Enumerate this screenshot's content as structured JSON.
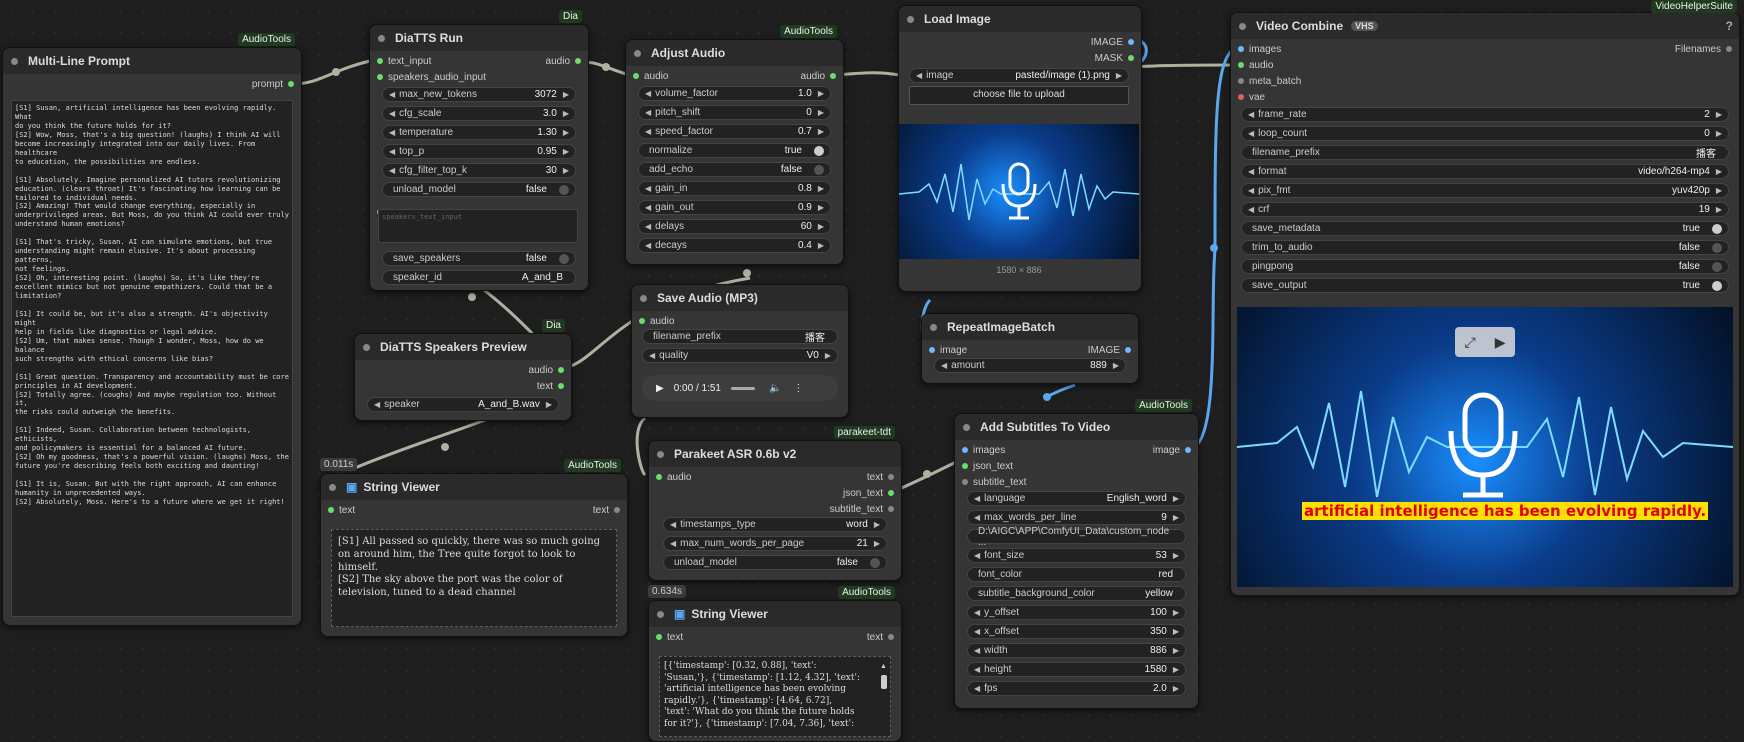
{
  "nodes": {
    "multi_line_prompt": {
      "title": "Multi-Line Prompt",
      "badge": "AudioTools",
      "out_prompt": "prompt",
      "text": "[S1] Susan, artificial intelligence has been evolving rapidly. What\ndo you think the future holds for it?\n[S2] Wow, Moss, that's a big question! (laughs) I think AI will\nbecome increasingly integrated into our daily lives. From healthcare\nto education, the possibilities are endless.\n\n[S1] Absolutely. Imagine personalized AI tutors revolutionizing\neducation. (clears throat) It's fascinating how learning can be\ntailored to individual needs.\n[S2] Amazing! That would change everything, especially in\nunderprivileged areas. But Moss, do you think AI could ever truly\nunderstand human emotions?\n\n[S1] That's tricky, Susan. AI can simulate emotions, but true\nunderstanding might remain elusive. It's about processing patterns,\nnot feelings.\n[S2] Oh, interesting point. (laughs) So, it's like they're\nexcellent mimics but not genuine empathizers. Could that be a\nlimitation?\n\n[S1] It could be, but it's also a strength. AI's objectivity might\nhelp in fields like diagnostics or legal advice.\n[S2] Um, that makes sense. Though I wonder, Moss, how do we balance\nsuch strengths with ethical concerns like bias?\n\n[S1] Great question. Transparency and accountability must be core\nprinciples in AI development.\n[S2] Totally agree. (coughs) And maybe regulation too. Without it,\nthe risks could outweigh the benefits.\n\n[S1] Indeed, Susan. Collaboration between technologists, ethicists,\nand policymakers is essential for a balanced AI future.\n[S2] Oh my goodness, that's a powerful vision. (laughs) Moss, the\nfuture you're describing feels both exciting and daunting!\n\n[S1] It is, Susan. But with the right approach, AI can enhance\nhumanity in unprecedented ways.\n[S2] Absolutely, Moss. Here's to a future where we get it right!"
    },
    "diatts_run": {
      "title": "DiaTTS Run",
      "badge": "Dia",
      "in_text": "text_input",
      "in_speakers": "speakers_audio_input",
      "out_audio": "audio",
      "widgets": [
        {
          "label": "max_new_tokens",
          "value": "3072"
        },
        {
          "label": "cfg_scale",
          "value": "3.0"
        },
        {
          "label": "temperature",
          "value": "1.30"
        },
        {
          "label": "top_p",
          "value": "0.95"
        },
        {
          "label": "cfg_filter_top_k",
          "value": "30"
        },
        {
          "label": "unload_model",
          "value": "false"
        }
      ],
      "speakers_text_placeholder": "speakers_text_input",
      "save_speakers": {
        "label": "save_speakers",
        "value": "false"
      },
      "speaker_id": {
        "label": "speaker_id",
        "value": "A_and_B"
      }
    },
    "adjust_audio": {
      "title": "Adjust Audio",
      "badge": "AudioTools",
      "in": "audio",
      "out": "audio",
      "widgets": [
        {
          "label": "volume_factor",
          "value": "1.0"
        },
        {
          "label": "pitch_shift",
          "value": "0"
        },
        {
          "label": "speed_factor",
          "value": "0.7"
        },
        {
          "label": "normalize",
          "value": "true"
        },
        {
          "label": "add_echo",
          "value": "false"
        },
        {
          "label": "gain_in",
          "value": "0.8"
        },
        {
          "label": "gain_out",
          "value": "0.9"
        },
        {
          "label": "delays",
          "value": "60"
        },
        {
          "label": "decays",
          "value": "0.4"
        }
      ]
    },
    "load_image": {
      "title": "Load Image",
      "out_image": "IMAGE",
      "out_mask": "MASK",
      "image_label": "image",
      "image_value": "pasted/image (1).png",
      "upload_label": "choose file to upload",
      "dims": "1580 × 886"
    },
    "video_combine": {
      "title": "Video Combine",
      "badge": "VideoHelperSuite",
      "vhs_label": "VHS",
      "inputs": [
        "images",
        "audio",
        "meta_batch",
        "vae"
      ],
      "out": "Filenames",
      "widgets": [
        {
          "label": "frame_rate",
          "value": "2"
        },
        {
          "label": "loop_count",
          "value": "0"
        },
        {
          "label": "filename_prefix",
          "value": "播客"
        },
        {
          "label": "format",
          "value": "video/h264-mp4"
        },
        {
          "label": "pix_fmt",
          "value": "yuv420p"
        },
        {
          "label": "crf",
          "value": "19"
        },
        {
          "label": "save_metadata",
          "value": "true"
        },
        {
          "label": "trim_to_audio",
          "value": "false"
        },
        {
          "label": "pingpong",
          "value": "false"
        },
        {
          "label": "save_output",
          "value": "true"
        }
      ],
      "subtitle": "artificial intelligence has been evolving rapidly."
    },
    "speakers_preview": {
      "title": "DiaTTS Speakers Preview",
      "badge": "Dia",
      "out_audio": "audio",
      "out_text": "text",
      "speaker": {
        "label": "speaker",
        "value": "A_and_B.wav"
      }
    },
    "save_audio": {
      "title": "Save Audio (MP3)",
      "in": "audio",
      "filename_prefix": {
        "label": "filename_prefix",
        "value": "播客"
      },
      "quality": {
        "label": "quality",
        "value": "V0"
      },
      "time": "0:00 / 1:51"
    },
    "repeat_image": {
      "title": "RepeatImageBatch",
      "in": "image",
      "out": "IMAGE",
      "amount": {
        "label": "amount",
        "value": "889"
      }
    },
    "string_viewer_1": {
      "title": "String Viewer",
      "badge": "AudioTools",
      "timing": "0.011s",
      "in": "text",
      "out": "text",
      "text": "[S1] All passed so quickly, there was so much going\non around him, the Tree quite forgot to look to\nhimself.\n[S2] The sky above the port was the color of\ntelevision, tuned to a dead channel"
    },
    "parakeet": {
      "title": "Parakeet ASR 0.6b v2",
      "badge": "parakeet-tdt",
      "in": "audio",
      "outs": [
        "text",
        "json_text",
        "subtitle_text"
      ],
      "widgets": [
        {
          "label": "timestamps_type",
          "value": "word"
        },
        {
          "label": "max_num_words_per_page",
          "value": "21"
        },
        {
          "label": "unload_model",
          "value": "false"
        }
      ]
    },
    "add_subtitles": {
      "title": "Add Subtitles To Video",
      "badge": "AudioTools",
      "inputs": [
        "images",
        "json_text",
        "subtitle_text"
      ],
      "out": "image",
      "widgets": [
        {
          "label": "language",
          "value": "English_word"
        },
        {
          "label": "max_words_per_line",
          "value": "9"
        },
        {
          "label": "",
          "value": "D:\\AIGC\\APP\\ComfyUI_Data\\custom_node ..."
        },
        {
          "label": "font_size",
          "value": "53"
        },
        {
          "label": "font_color",
          "value": "red"
        },
        {
          "label": "subtitle_background_color",
          "value": "yellow"
        },
        {
          "label": "y_offset",
          "value": "100"
        },
        {
          "label": "x_offset",
          "value": "350"
        },
        {
          "label": "width",
          "value": "886"
        },
        {
          "label": "height",
          "value": "1580"
        },
        {
          "label": "fps",
          "value": "2.0"
        }
      ]
    },
    "string_viewer_2": {
      "title": "String Viewer",
      "badge": "AudioTools",
      "timing": "0.634s",
      "in": "text",
      "out": "text",
      "text": "[{'timestamp': [0.32, 0.88], 'text':\n'Susan,'}, {'timestamp': [1.12, 4.32], 'text':\n'artificial intelligence has been evolving\nrapidly.'}, {'timestamp': [4.64, 6.72],\n'text': 'What do you think the future holds\nfor it?'}, {'timestamp': [7.04, 7.36], 'text':"
    }
  },
  "colors": {
    "wire_green": "#aab8a0",
    "wire_blue": "#5aa8f0",
    "subtitle_bg": "#ffe000",
    "subtitle_fg": "#e00000"
  }
}
